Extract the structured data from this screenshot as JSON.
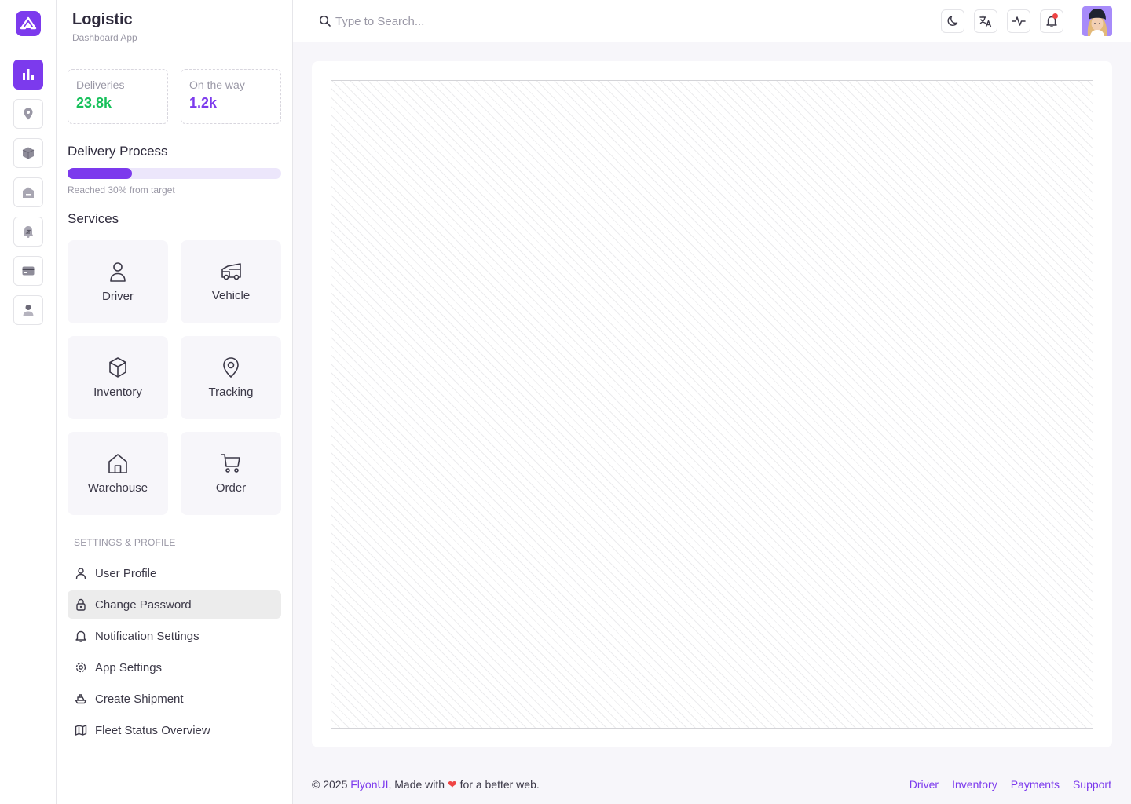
{
  "app": {
    "title": "Logistic",
    "subtitle": "Dashboard App"
  },
  "rail": {
    "items": [
      {
        "icon": "bar-chart-icon",
        "active": true
      },
      {
        "icon": "map-pin-icon",
        "active": false
      },
      {
        "icon": "box-icon",
        "active": false
      },
      {
        "icon": "warehouse-icon",
        "active": false
      },
      {
        "icon": "support-icon",
        "active": false
      },
      {
        "icon": "credit-card-icon",
        "active": false
      },
      {
        "icon": "user-icon",
        "active": false
      }
    ]
  },
  "stats": [
    {
      "label": "Deliveries",
      "value": "23.8k",
      "color": "#16c05a"
    },
    {
      "label": "On the way",
      "value": "1.2k",
      "color": "#7c3aed"
    }
  ],
  "delivery": {
    "title": "Delivery Process",
    "progress_percent": 30,
    "note": "Reached 30% from target"
  },
  "services": {
    "title": "Services",
    "items": [
      {
        "label": "Driver",
        "icon": "user-icon"
      },
      {
        "label": "Vehicle",
        "icon": "truck-icon"
      },
      {
        "label": "Inventory",
        "icon": "box-icon"
      },
      {
        "label": "Tracking",
        "icon": "map-pin-icon"
      },
      {
        "label": "Warehouse",
        "icon": "home-icon"
      },
      {
        "label": "Order",
        "icon": "cart-icon"
      }
    ]
  },
  "settings": {
    "heading": "SETTINGS & PROFILE",
    "items": [
      {
        "label": "User Profile",
        "icon": "user-icon",
        "active": false
      },
      {
        "label": "Change Password",
        "icon": "lock-icon",
        "active": true
      },
      {
        "label": "Notification Settings",
        "icon": "bell-icon",
        "active": false
      },
      {
        "label": "App Settings",
        "icon": "gear-icon",
        "active": false
      },
      {
        "label": "Create Shipment",
        "icon": "ship-icon",
        "active": false
      },
      {
        "label": "Fleet Status Overview",
        "icon": "map-icon",
        "active": false
      }
    ]
  },
  "topbar": {
    "search_placeholder": "Type to Search...",
    "icons": [
      "moon-icon",
      "translate-icon",
      "activity-icon",
      "bell-icon"
    ],
    "notification_dot_color": "#ef4444"
  },
  "footer": {
    "copyright": "© 2025 ",
    "brand": "FlyonUI",
    "made_with": ", Made with ",
    "suffix": " for a better web.",
    "links": [
      "Driver",
      "Inventory",
      "Payments",
      "Support"
    ]
  },
  "colors": {
    "accent": "#7c3aed",
    "success": "#16c05a",
    "danger": "#ef4444"
  }
}
